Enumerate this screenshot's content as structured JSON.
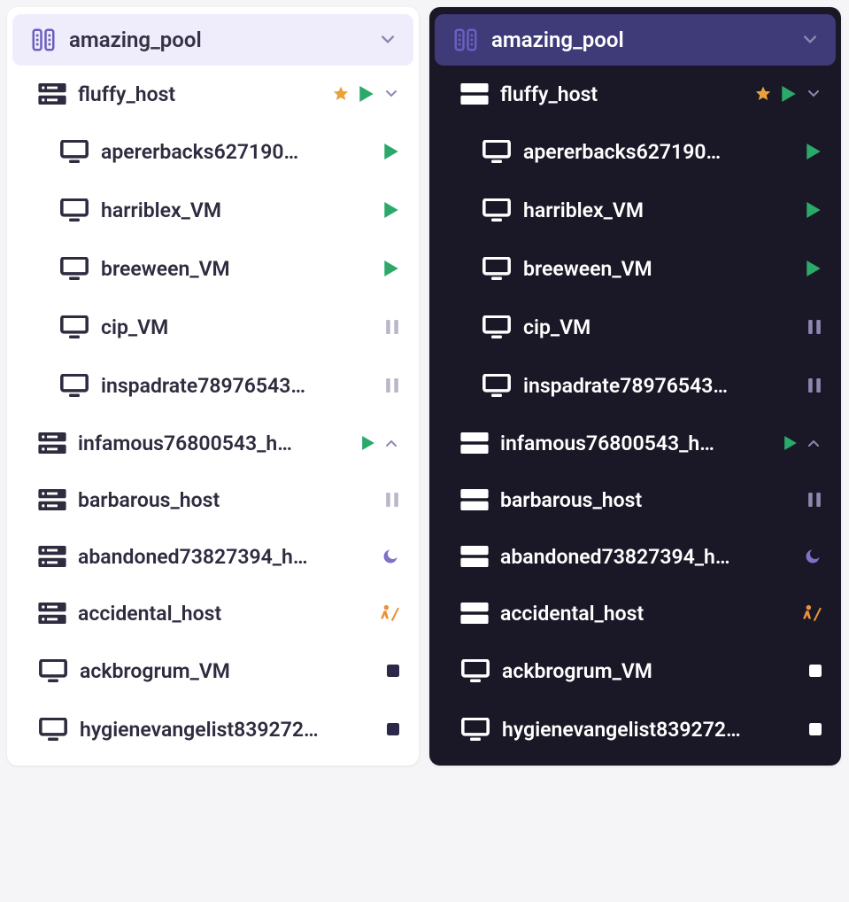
{
  "pool": {
    "name": "amazing_pool"
  },
  "items": [
    {
      "type": "host",
      "name": "fluffy_host",
      "indent": 1,
      "star": true,
      "status": "play",
      "expandable": "down"
    },
    {
      "type": "vm",
      "name": "apererbacks627190…",
      "indent": 2,
      "status": "play"
    },
    {
      "type": "vm",
      "name": "harriblex_VM",
      "indent": 2,
      "status": "play"
    },
    {
      "type": "vm",
      "name": "breeween_VM",
      "indent": 2,
      "status": "play"
    },
    {
      "type": "vm",
      "name": "cip_VM",
      "indent": 2,
      "status": "pause"
    },
    {
      "type": "vm",
      "name": "inspadrate78976543…",
      "indent": 2,
      "status": "pause"
    },
    {
      "type": "host",
      "name": "infamous76800543_h…",
      "indent": 1,
      "status": "play",
      "expandable": "up"
    },
    {
      "type": "host",
      "name": "barbarous_host",
      "indent": 1,
      "status": "pause"
    },
    {
      "type": "host",
      "name": "abandoned73827394_h…",
      "indent": 1,
      "status": "moon"
    },
    {
      "type": "host",
      "name": "accidental_host",
      "indent": 1,
      "status": "work"
    },
    {
      "type": "vm",
      "name": "ackbrogrum_VM",
      "indent": 1,
      "status": "stop"
    },
    {
      "type": "vm",
      "name": "hygienevangelist839272…",
      "indent": 1,
      "status": "stop"
    }
  ],
  "icons": {
    "pool": "pool-icon",
    "host": "server-icon",
    "vm": "monitor-icon",
    "star": "star-icon",
    "play": "play-icon",
    "pause": "pause-icon",
    "moon": "moon-icon",
    "construction": "construction-icon",
    "stop": "stop-icon",
    "chevron_down": "chevron-down-icon",
    "chevron_up": "chevron-up-icon"
  },
  "themes": {
    "left": "light",
    "right": "dark"
  }
}
